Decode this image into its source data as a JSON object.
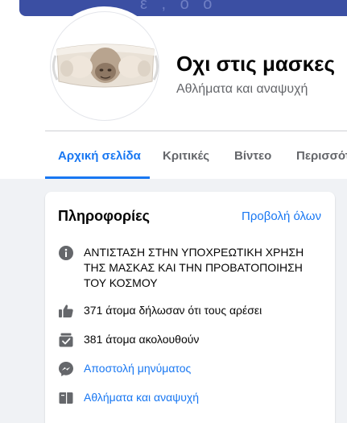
{
  "page": {
    "title": "Οχι στις μασκες",
    "category": "Αθλήματα και αναψυχή"
  },
  "tabs": [
    {
      "label": "Αρχική σελίδα",
      "active": true
    },
    {
      "label": "Κριτικές"
    },
    {
      "label": "Βίντεο"
    },
    {
      "label": "Περισσότ"
    }
  ],
  "info": {
    "title": "Πληροφορίες",
    "see_all": "Προβολή όλων",
    "items": [
      {
        "icon": "info-icon",
        "text": "ΑΝΤΙΣΤΑΣΗ ΣΤΗΝ ΥΠΟΧΡΕΩΤΙΚΗ ΧΡΗΣΗ ΤΗΣ ΜΑΣΚΑΣ ΚΑΙ ΤΗΝ ΠΡΟΒΑΤΟΠΟΙΗΣΗ ΤΟΥ ΚΟΣΜΟΥ"
      },
      {
        "icon": "thumbs-up-icon",
        "text": "371 άτομα δήλωσαν ότι τους αρέσει"
      },
      {
        "icon": "follow-icon",
        "text": "381 άτομα ακολουθούν"
      },
      {
        "icon": "messenger-icon",
        "text": "Αποστολή μηνύματος"
      },
      {
        "icon": "category-icon",
        "text": "Αθλήματα και αναψυχή"
      }
    ]
  },
  "colors": {
    "accent": "#1877f2",
    "icon_gray": "#65676b",
    "cover": "#3b4fa3"
  }
}
